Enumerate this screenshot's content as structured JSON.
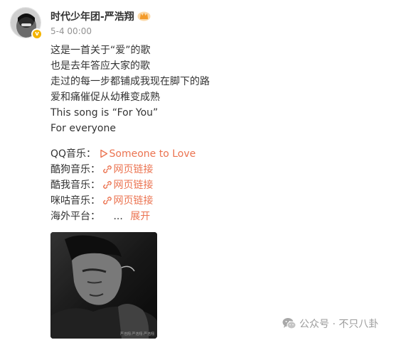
{
  "header": {
    "author_name": "时代少年团-严浩翔",
    "timestamp": "5-4 00:00",
    "avatar_icon": "user-avatar",
    "verified_icon": "verified-badge-icon",
    "badge_icon": "crown-badge-icon"
  },
  "content": {
    "lines": [
      "这是一首关于“爱”的歌",
      "也是去年答应大家的歌",
      "走过的每一步都铺成我现在脚下的路",
      "爱和痛催促从幼稚变成熟",
      "This song is “For You”",
      "For everyone"
    ],
    "music": [
      {
        "platform": "QQ音乐：",
        "icon": "play-triangle-icon",
        "link_text": "Someone to Love"
      },
      {
        "platform": "酷狗音乐：",
        "icon": "link-icon",
        "link_text": "网页链接"
      },
      {
        "platform": "酷我音乐：",
        "icon": "link-icon",
        "link_text": "网页链接"
      },
      {
        "platform": "咪咕音乐：",
        "icon": "link-icon",
        "link_text": "网页链接"
      }
    ],
    "overseas": {
      "label": "海外平台：",
      "ellipsis": "...",
      "expand": "展开"
    }
  },
  "photo": {
    "caption": "严浩翔·严浩翔·严浩翔"
  },
  "watermark": {
    "text": "公众号 · 不只八卦",
    "icon": "wechat-icon"
  },
  "colors": {
    "link": "#eb7350",
    "text": "#333333",
    "meta": "#939393"
  }
}
